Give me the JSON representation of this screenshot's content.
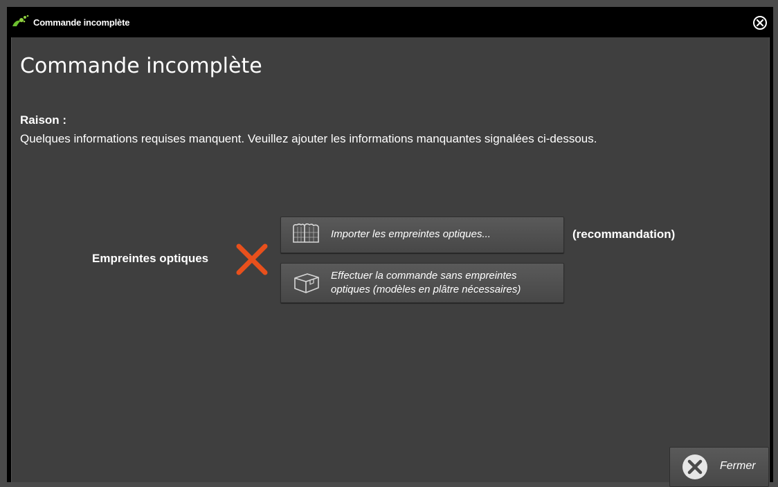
{
  "window": {
    "title": "Commande incomplète",
    "logo_icon": "app-logo-icon",
    "close_icon": "close-circle-icon"
  },
  "main": {
    "heading": "Commande incomplète",
    "reason_label": "Raison :",
    "reason_text": "Quelques informations requises manquent. Veuillez ajouter les informations manquantes signalées ci-dessous."
  },
  "requirement": {
    "label": "Empreintes optiques",
    "status_icon": "missing-x-icon",
    "status_color": "#e8501c",
    "import_button": {
      "label": "Importer les empreintes optiques...",
      "icon": "dental-scan-icon"
    },
    "recommendation": "(recommandation)",
    "no_scan_button": {
      "label_line1": "Effectuer la commande sans empreintes",
      "label_line2": "optiques (modèles en plâtre nécessaires)",
      "icon": "package-box-icon"
    }
  },
  "footer": {
    "close_label": "Fermer",
    "close_icon": "close-circle-icon"
  }
}
